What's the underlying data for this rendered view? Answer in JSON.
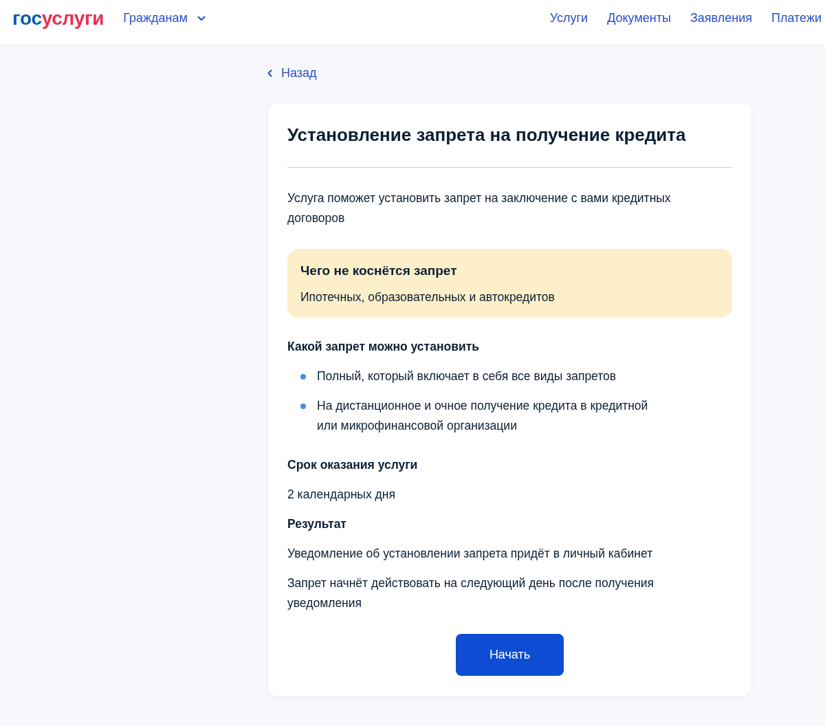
{
  "header": {
    "logo": {
      "parts": [
        "гос",
        "услуги"
      ]
    },
    "menu": {
      "label": "Гражданам"
    },
    "nav": [
      {
        "label": "Услуги"
      },
      {
        "label": "Документы"
      },
      {
        "label": "Заявления"
      },
      {
        "label": "Платежи"
      }
    ]
  },
  "back": {
    "label": "Назад"
  },
  "card": {
    "title": "Установление запрета на получение кредита",
    "intro": "Услуга поможет установить запрет на заключение с вами кредитных договоров",
    "notice": {
      "title": "Чего не коснётся запрет",
      "text": "Ипотечных, образовательных и автокредитов"
    },
    "sections": [
      {
        "kind": "bullets",
        "heading": "Какой запрет можно установить",
        "items": [
          "Полный, который включает в себя все виды запретов",
          "На дистанционное и очное получение кредита в кредитной или микрофинансовой организации"
        ]
      },
      {
        "kind": "text",
        "heading": "Срок оказания услуги",
        "items": [
          "2 календарных дня"
        ]
      },
      {
        "kind": "text",
        "heading": "Результат",
        "items": [
          "Уведомление об установлении запрета придёт в личный кабинет",
          "Запрет начнёт действовать на следующий день после получения уведомления"
        ]
      }
    ],
    "button": {
      "label": "Начать"
    }
  }
}
